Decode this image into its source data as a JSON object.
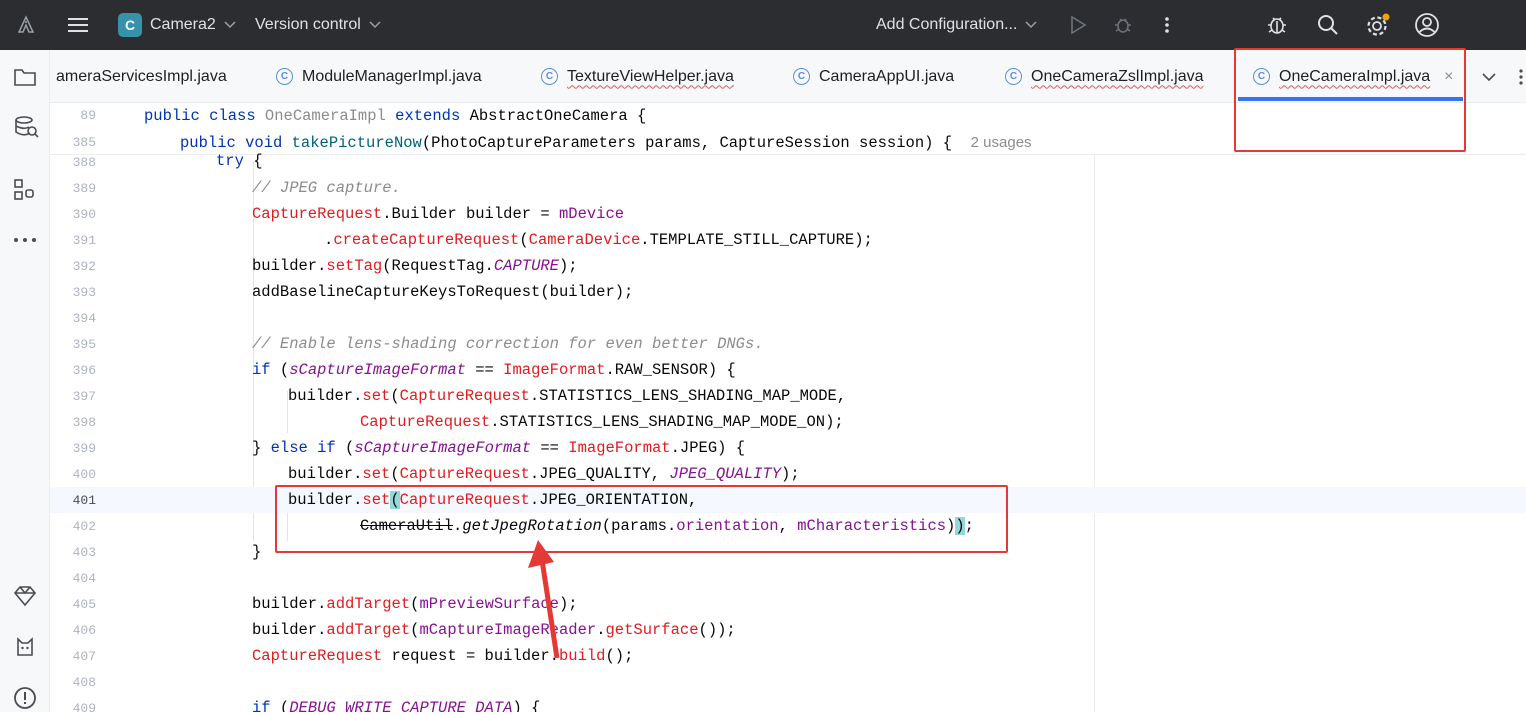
{
  "titlebar": {
    "project_badge": "C",
    "project_name": "Camera2",
    "vcs_label": "Version control",
    "run_config": "Add Configuration...",
    "icons": [
      "android-logo-icon",
      "hamburger-menu-icon",
      "chevron-down-icon",
      "run-icon",
      "debug-icon",
      "more-vert-icon",
      "bug-plugin-icon",
      "search-icon",
      "settings-icon",
      "account-icon"
    ]
  },
  "sidebar": {
    "icons": [
      "project-folder-icon",
      "database-icon",
      "structure-icon",
      "more-icon",
      "gem-icon",
      "cat-icon",
      "problems-icon"
    ]
  },
  "tabs": [
    {
      "label": "ameraServicesImpl.java",
      "error": false
    },
    {
      "label": "ModuleManagerImpl.java",
      "error": false
    },
    {
      "label": "TextureViewHelper.java",
      "error": true
    },
    {
      "label": "CameraAppUI.java",
      "error": false
    },
    {
      "label": "OneCameraZslImpl.java",
      "error": true
    },
    {
      "label": "OneCameraImpl.java",
      "error": true,
      "active": true
    }
  ],
  "tab_close": "×",
  "editor": {
    "sticky": [
      {
        "num": "89",
        "text": "public class OneCameraImpl extends AbstractOneCamera {"
      },
      {
        "num": "385",
        "text": "public void takePictureNow(PhotoCaptureParameters params, CaptureSession session) {",
        "usages": "2 usages"
      }
    ],
    "lines": [
      {
        "num": "388",
        "text": "try {"
      },
      {
        "num": "389",
        "text": "// JPEG capture."
      },
      {
        "num": "390",
        "text": "CaptureRequest.Builder builder = mDevice"
      },
      {
        "num": "391",
        "text": ".createCaptureRequest(CameraDevice.TEMPLATE_STILL_CAPTURE);"
      },
      {
        "num": "392",
        "text": "builder.setTag(RequestTag.CAPTURE);"
      },
      {
        "num": "393",
        "text": "addBaselineCaptureKeysToRequest(builder);"
      },
      {
        "num": "394",
        "text": ""
      },
      {
        "num": "395",
        "text": "// Enable lens-shading correction for even better DNGs."
      },
      {
        "num": "396",
        "text": "if (sCaptureImageFormat == ImageFormat.RAW_SENSOR) {"
      },
      {
        "num": "397",
        "text": "builder.set(CaptureRequest.STATISTICS_LENS_SHADING_MAP_MODE,"
      },
      {
        "num": "398",
        "text": "CaptureRequest.STATISTICS_LENS_SHADING_MAP_MODE_ON);"
      },
      {
        "num": "399",
        "text": "} else if (sCaptureImageFormat == ImageFormat.JPEG) {"
      },
      {
        "num": "400",
        "text": "builder.set(CaptureRequest.JPEG_QUALITY, JPEG_QUALITY);"
      },
      {
        "num": "401",
        "text": "builder.set(CaptureRequest.JPEG_ORIENTATION,"
      },
      {
        "num": "402",
        "text": "CameraUtil.getJpegRotation(params.orientation, mCharacteristics));"
      },
      {
        "num": "403",
        "text": "}"
      },
      {
        "num": "404",
        "text": ""
      },
      {
        "num": "405",
        "text": "builder.addTarget(mPreviewSurface);"
      },
      {
        "num": "406",
        "text": "builder.addTarget(mCaptureImageReader.getSurface());"
      },
      {
        "num": "407",
        "text": "CaptureRequest request = builder.build();"
      },
      {
        "num": "408",
        "text": ""
      },
      {
        "num": "409",
        "text": "if (DEBUG_WRITE_CAPTURE_DATA) {"
      }
    ]
  },
  "colors": {
    "titlebar_bg": "#2b2d30",
    "accent_blue": "#3574f0",
    "annotation_red": "#e53935",
    "keyword": "#0033b3",
    "class_ref": "#e01c1c",
    "field": "#871094",
    "comment": "#8c8c8c"
  }
}
